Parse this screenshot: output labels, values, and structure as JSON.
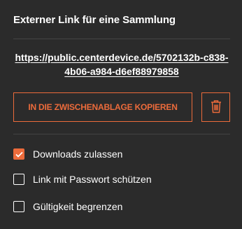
{
  "panel": {
    "title": "Externer Link für eine Sammlung",
    "link_url": "https://public.centerdevice.de/5702132b-c838-4b06-a984-d6ef88979858",
    "copy_button_label": "IN DIE ZWISCHENABLAGE KOPIEREN",
    "delete_icon": "trash-icon"
  },
  "options": [
    {
      "label": "Downloads zulassen",
      "checked": true
    },
    {
      "label": "Link mit Passwort schützen",
      "checked": false
    },
    {
      "label": "Gültigkeit begrenzen",
      "checked": false
    }
  ],
  "colors": {
    "accent": "#ec6b3b",
    "background": "#2b2b2b",
    "text": "#ffffff",
    "divider": "#444444"
  }
}
